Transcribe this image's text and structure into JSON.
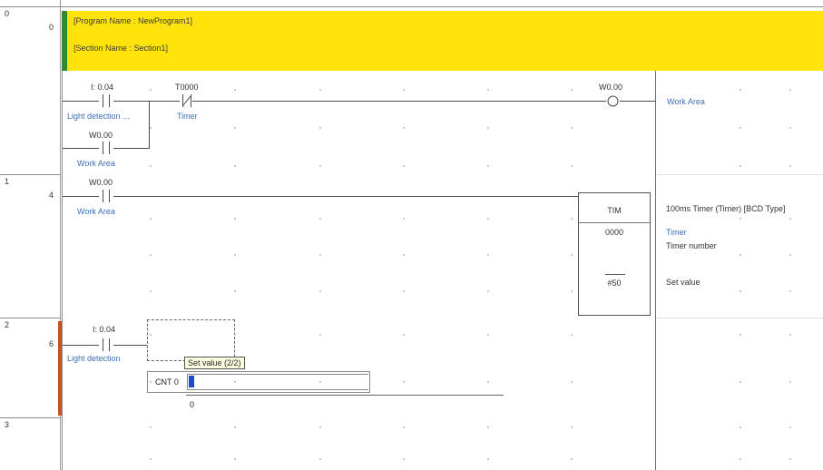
{
  "banner": {
    "program_name": "[Program Name : NewProgram1]",
    "section_name": "[Section Name : Section1]",
    "color": "#ffe30a",
    "bar_color": "#2e8b2e"
  },
  "rungs": [
    {
      "rung": "0",
      "step": "0"
    },
    {
      "rung": "1",
      "step": "4"
    },
    {
      "rung": "2",
      "step": "6"
    },
    {
      "rung": "3",
      "step": ""
    }
  ],
  "rung0": {
    "contact1_addr": "I: 0.04",
    "contact1_comment": "Light detection ...",
    "contact2_addr": "T0000",
    "contact2_comment": "Timer",
    "branch_addr": "W0.00",
    "branch_comment": "Work Area",
    "coil_addr": "W0.00",
    "coil_comment": "Work Area"
  },
  "rung1": {
    "contact_addr": "W0.00",
    "contact_comment": "Work Area",
    "instr": "TIM",
    "operand1": "0000",
    "operand2": "#50",
    "desc": "100ms Timer (Timer) [BCD Type]",
    "op1_comment": "Timer",
    "op1_label": "Timer number",
    "op2_label": "Set value"
  },
  "rung2": {
    "contact_addr": "I: 0.04",
    "contact_comment": "Light detection",
    "tooltip": "Set value (2/2)",
    "input_label": "CNT 0",
    "input_value": "",
    "suggest_value": "0"
  },
  "colors": {
    "comment": "#3d6fb8",
    "rung_marker": "#c8502a",
    "selection": "#1e4cc8"
  }
}
